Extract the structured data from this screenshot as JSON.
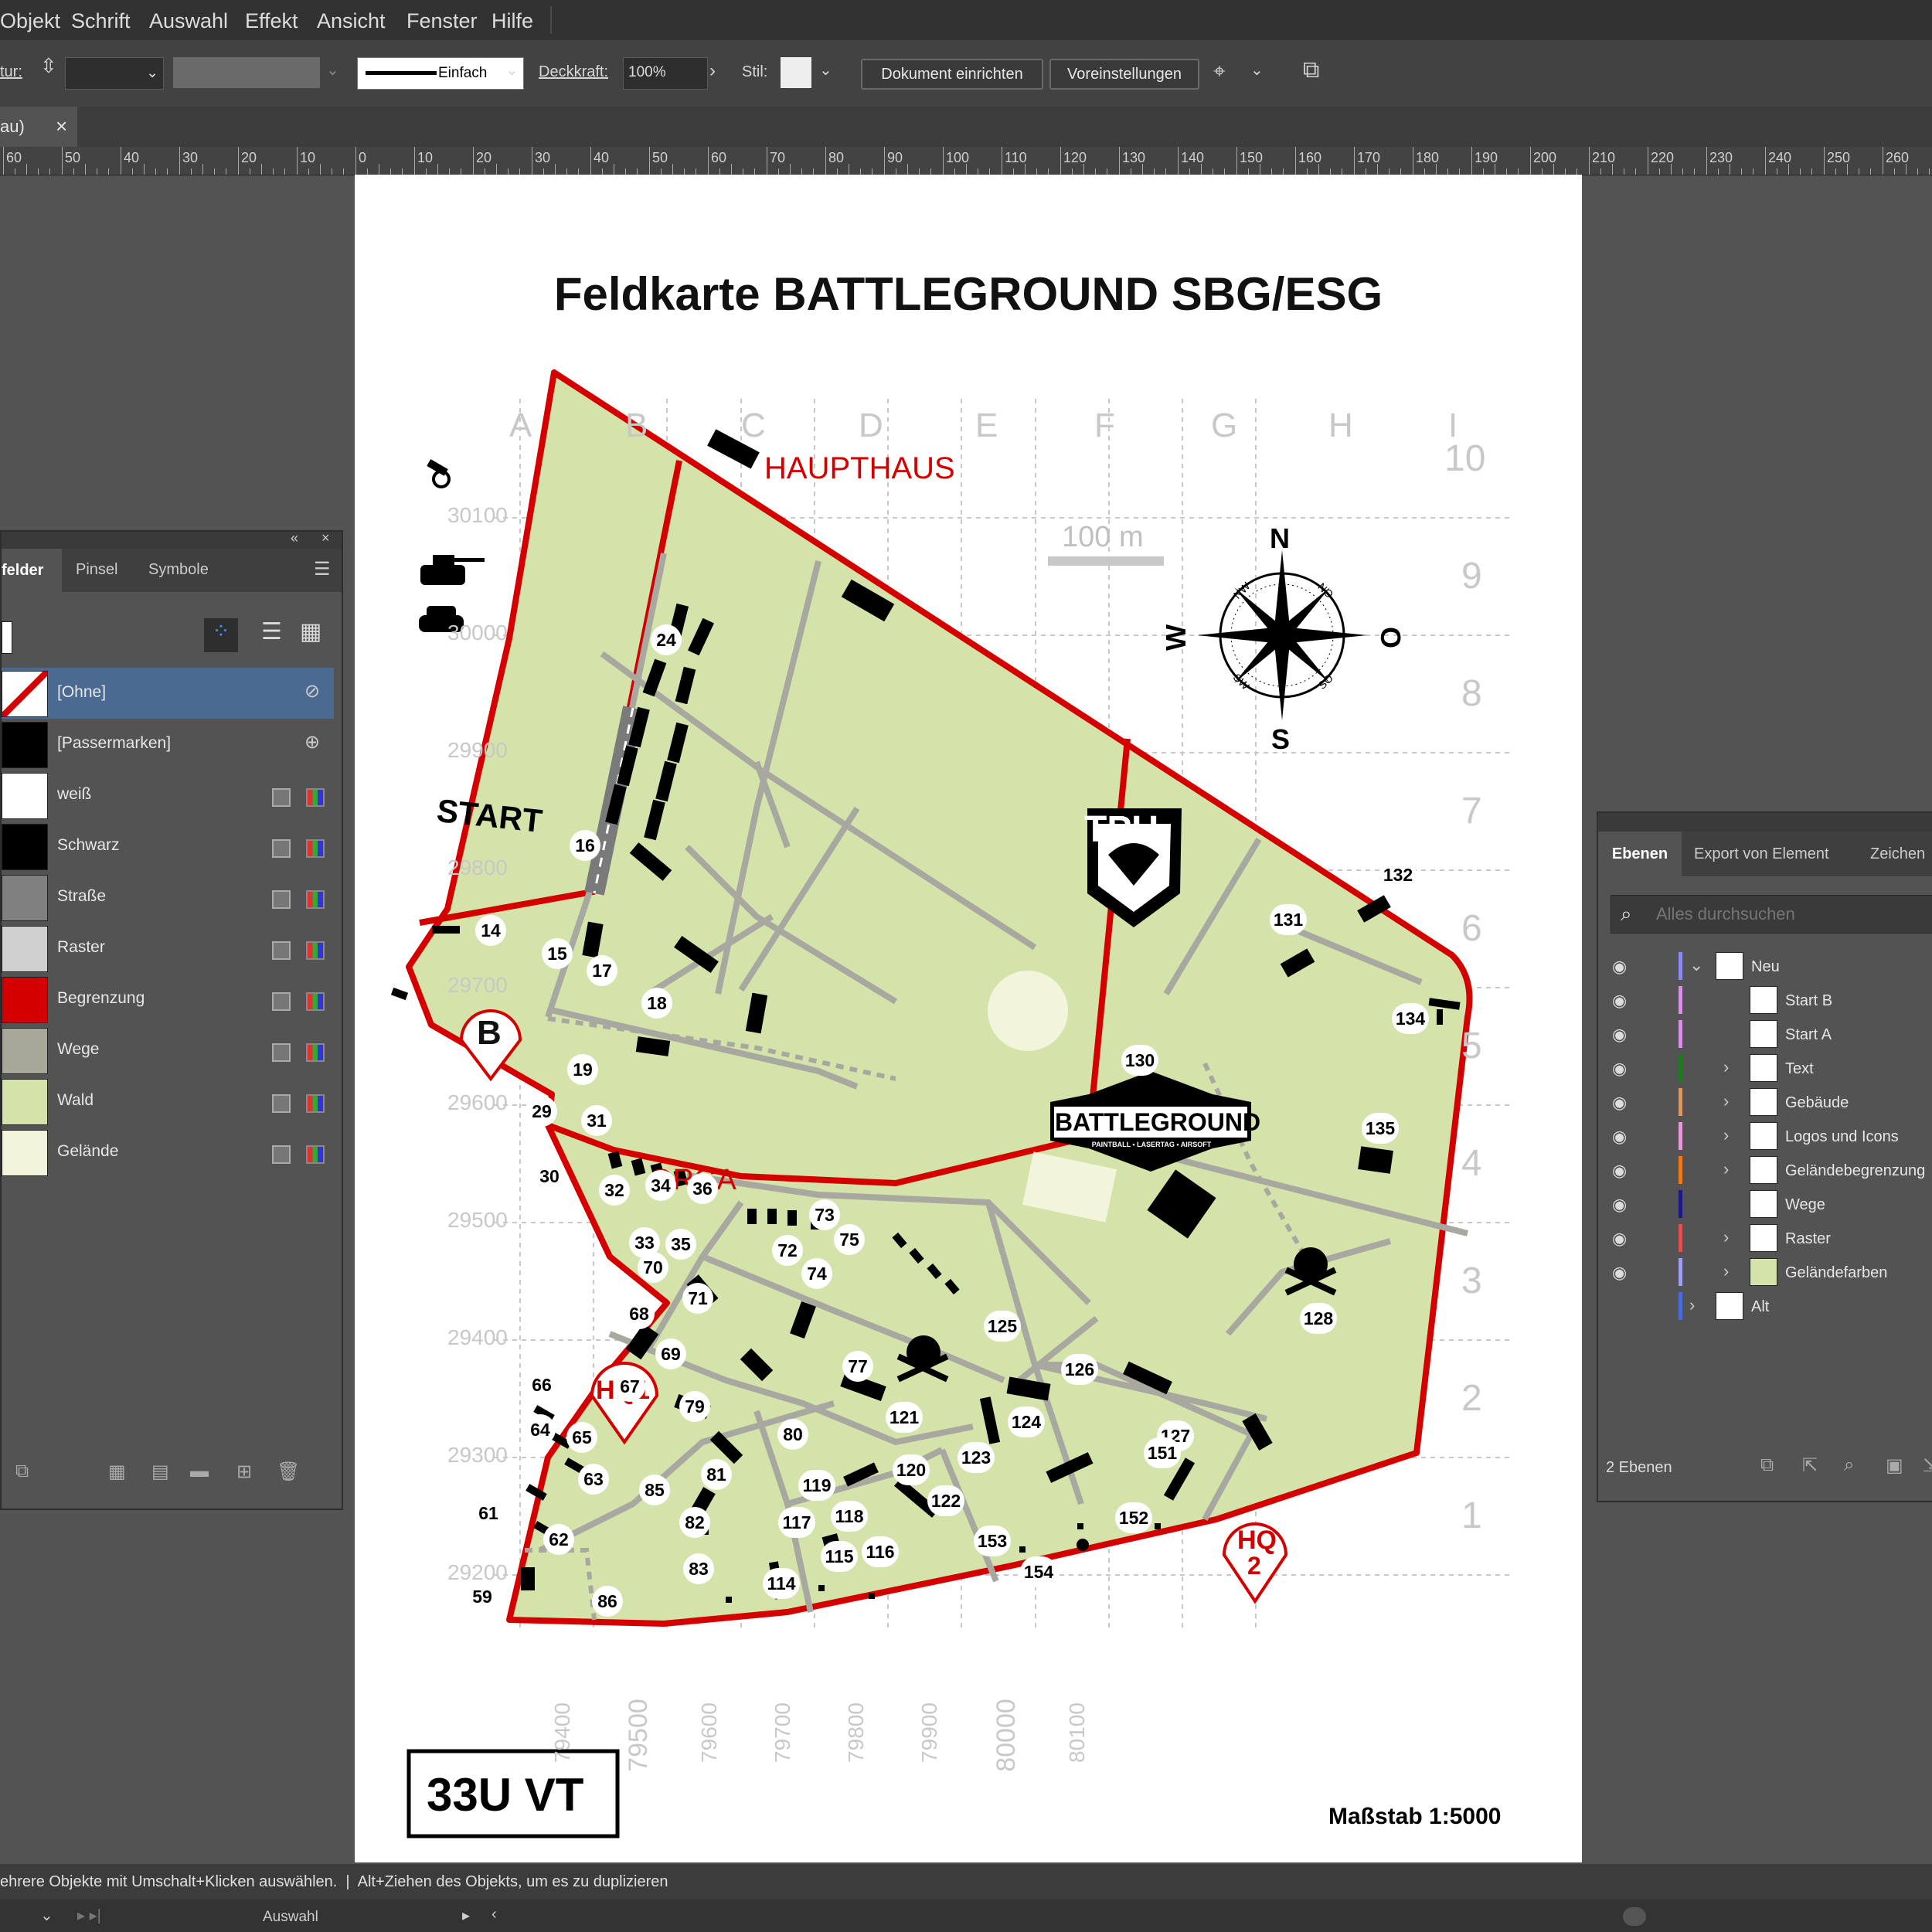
{
  "menu": [
    "Objekt",
    "Schrift",
    "Auswahl",
    "Effekt",
    "Ansicht",
    "Fenster",
    "Hilfe"
  ],
  "control_bar": {
    "kontur_label": "tur:",
    "stroke_style": "Einfach",
    "opacity_label": "Deckkraft:",
    "opacity_value": "100%",
    "style_label": "Stil:",
    "doc_setup_button": "Dokument einrichten",
    "preferences_button": "Voreinstellungen"
  },
  "doc_tab": {
    "title": "au)",
    "close": "×"
  },
  "ruler_labels": [
    "60",
    "50",
    "40",
    "30",
    "20",
    "10",
    "0",
    "10",
    "20",
    "30",
    "40",
    "50",
    "60",
    "70",
    "80",
    "90",
    "100",
    "110",
    "120",
    "130",
    "140",
    "150",
    "160",
    "170",
    "180",
    "190",
    "200",
    "210",
    "220",
    "230",
    "240",
    "250",
    "260"
  ],
  "swatches_panel": {
    "tabs": [
      "felder",
      "Pinsel",
      "Symbole"
    ],
    "items": [
      {
        "name": "[Ohne]",
        "color": "#ffffff"
      },
      {
        "name": "[Passermarken]",
        "color": "#000000"
      },
      {
        "name": "weiß",
        "color": "#ffffff"
      },
      {
        "name": "Schwarz",
        "color": "#000000"
      },
      {
        "name": "Straße",
        "color": "#808080"
      },
      {
        "name": "Raster",
        "color": "#d0d0d0"
      },
      {
        "name": "Begrenzung",
        "color": "#d40000"
      },
      {
        "name": "Wege",
        "color": "#a8a89a"
      },
      {
        "name": "Wald",
        "color": "#d3e3a9"
      },
      {
        "name": "Gelände",
        "color": "#f3f4dc"
      }
    ]
  },
  "layers_panel": {
    "tabs": [
      "Ebenen",
      "Export von Element",
      "Zeichen"
    ],
    "search_placeholder": "Alles durchsuchen",
    "layers": [
      {
        "name": "Neu",
        "color": "#8b8bf0",
        "level": 0,
        "expanded": true
      },
      {
        "name": "Start B",
        "color": "#d88fe8",
        "level": 1
      },
      {
        "name": "Start A",
        "color": "#d88fe8",
        "level": 1
      },
      {
        "name": "Text",
        "color": "#1f7a1f",
        "level": 1
      },
      {
        "name": "Gebäude",
        "color": "#d99a66",
        "level": 1
      },
      {
        "name": "Logos und Icons",
        "color": "#e89ad8",
        "level": 1
      },
      {
        "name": "Geländebegrenzung",
        "color": "#f07a1a",
        "level": 1
      },
      {
        "name": "Wege",
        "color": "#1a1a8a",
        "level": 1
      },
      {
        "name": "Raster",
        "color": "#e05050",
        "level": 1
      },
      {
        "name": "Geländefarben",
        "color": "#a0a0f0",
        "level": 1
      },
      {
        "name": "Alt",
        "color": "#4a6ae0",
        "level": 0
      }
    ],
    "footer": "2 Ebenen"
  },
  "map": {
    "title": "Feldkarte BATTLEGROUND SBG/ESG",
    "grid_letters": [
      "A",
      "B",
      "C",
      "D",
      "E",
      "F",
      "G",
      "H",
      "I"
    ],
    "grid_numbers": [
      "10",
      "9",
      "8",
      "7",
      "6",
      "5",
      "4",
      "3",
      "2",
      "1"
    ],
    "northing": [
      "30100",
      "30000",
      "29900",
      "29800",
      "29700",
      "29600",
      "29500",
      "29400",
      "29300",
      "29200"
    ],
    "easting": [
      "79400",
      "79500",
      "79600",
      "79700",
      "79800",
      "79900",
      "80000",
      "80100"
    ],
    "scale_bar": "100 m",
    "labels": {
      "haupthaus": "HAUPTHAUS",
      "orga": "ORGA",
      "start": "START",
      "start_letter": "B",
      "hq1": "HQ1",
      "hq2_a": "HQ",
      "hq2_b": "2"
    },
    "compass": {
      "n": "N",
      "s": "S",
      "w": "W",
      "o": "O",
      "nw": "NW",
      "no": "NO",
      "sw": "SW",
      "so": "SO"
    },
    "logo_battleground": {
      "main": "BATTLEGROUND",
      "sub": "PAINTBALL • LASERTAG • AIRSOFT"
    },
    "logo_tpu": "TPU",
    "zone": "33U VT",
    "scale": "Maßstab 1:5000",
    "numbers": [
      "14",
      "15",
      "16",
      "17",
      "18",
      "19",
      "24",
      "29",
      "30",
      "31",
      "32",
      "33",
      "34",
      "35",
      "36",
      "59",
      "61",
      "62",
      "63",
      "64",
      "65",
      "66",
      "67",
      "68",
      "69",
      "70",
      "71",
      "72",
      "73",
      "74",
      "75",
      "77",
      "79",
      "80",
      "81",
      "82",
      "83",
      "85",
      "86",
      "114",
      "115",
      "116",
      "117",
      "118",
      "119",
      "120",
      "121",
      "122",
      "123",
      "124",
      "125",
      "126",
      "127",
      "128",
      "130",
      "131",
      "132",
      "134",
      "135",
      "151",
      "152",
      "153",
      "154"
    ]
  },
  "status": {
    "hint": "ehrere Objekte mit Umschalt+Klicken auswählen.  |  Alt+Ziehen des Objekts, um es zu duplizieren",
    "tool": "Auswahl"
  },
  "colors": {
    "boundary": "#d40000",
    "terrain": "#d3e3a9",
    "path": "#a8a8a0",
    "panel": "#535353"
  }
}
